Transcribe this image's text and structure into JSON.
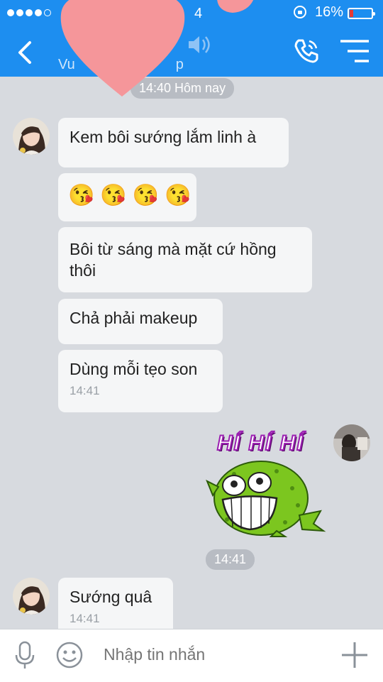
{
  "status_bar": {
    "time_partial": "4",
    "battery_percent": "16%",
    "colors": {
      "bar": "#1d8ef0",
      "battery_low": "#e53935"
    }
  },
  "header": {
    "contact_subtitle_partial": "Vu",
    "contact_subtitle_partial_end": "p",
    "icons": [
      "back-icon",
      "mute-icon",
      "phone-call-icon",
      "menu-icon"
    ]
  },
  "chat": {
    "date_pill": "14:40 Hôm nay",
    "messages": [
      {
        "text": "Kem bôi sướng lắm linh à"
      },
      {
        "emoji": [
          "😘",
          "😘",
          "😘",
          "😘"
        ]
      },
      {
        "text": "Bôi từ sáng mà mặt cứ hồng thôi"
      },
      {
        "text": "Chả phải makeup"
      },
      {
        "text": "Dùng mỗi tẹo son",
        "time": "14:41"
      },
      {
        "sticker_text": "HÍ HÍ HÍ",
        "sticker_name": "laughing-green-pufferfish"
      },
      {
        "pill_time": "14:41"
      },
      {
        "text": "Sướng quâ",
        "time": "14:41"
      }
    ]
  },
  "input_bar": {
    "placeholder": "Nhập tin nhắn"
  }
}
